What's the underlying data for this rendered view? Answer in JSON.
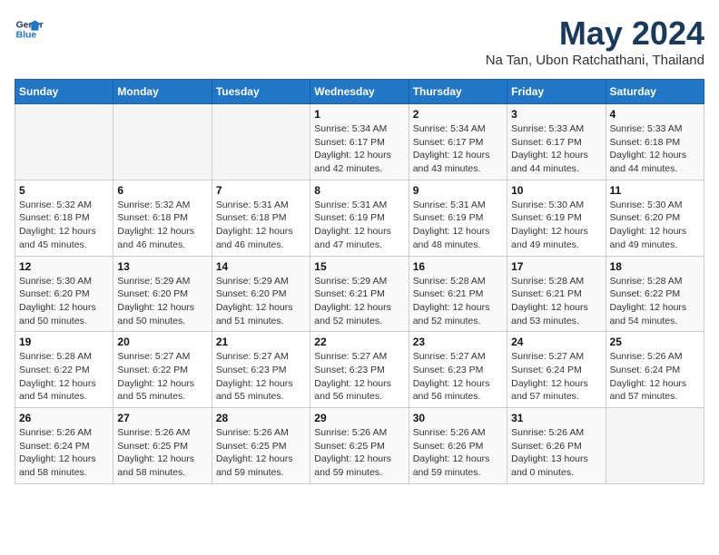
{
  "logo": {
    "line1": "General",
    "line2": "Blue"
  },
  "title": "May 2024",
  "subtitle": "Na Tan, Ubon Ratchathani, Thailand",
  "days_of_week": [
    "Sunday",
    "Monday",
    "Tuesday",
    "Wednesday",
    "Thursday",
    "Friday",
    "Saturday"
  ],
  "weeks": [
    [
      {
        "day": "",
        "info": ""
      },
      {
        "day": "",
        "info": ""
      },
      {
        "day": "",
        "info": ""
      },
      {
        "day": "1",
        "info": "Sunrise: 5:34 AM\nSunset: 6:17 PM\nDaylight: 12 hours\nand 42 minutes."
      },
      {
        "day": "2",
        "info": "Sunrise: 5:34 AM\nSunset: 6:17 PM\nDaylight: 12 hours\nand 43 minutes."
      },
      {
        "day": "3",
        "info": "Sunrise: 5:33 AM\nSunset: 6:17 PM\nDaylight: 12 hours\nand 44 minutes."
      },
      {
        "day": "4",
        "info": "Sunrise: 5:33 AM\nSunset: 6:18 PM\nDaylight: 12 hours\nand 44 minutes."
      }
    ],
    [
      {
        "day": "5",
        "info": "Sunrise: 5:32 AM\nSunset: 6:18 PM\nDaylight: 12 hours\nand 45 minutes."
      },
      {
        "day": "6",
        "info": "Sunrise: 5:32 AM\nSunset: 6:18 PM\nDaylight: 12 hours\nand 46 minutes."
      },
      {
        "day": "7",
        "info": "Sunrise: 5:31 AM\nSunset: 6:18 PM\nDaylight: 12 hours\nand 46 minutes."
      },
      {
        "day": "8",
        "info": "Sunrise: 5:31 AM\nSunset: 6:19 PM\nDaylight: 12 hours\nand 47 minutes."
      },
      {
        "day": "9",
        "info": "Sunrise: 5:31 AM\nSunset: 6:19 PM\nDaylight: 12 hours\nand 48 minutes."
      },
      {
        "day": "10",
        "info": "Sunrise: 5:30 AM\nSunset: 6:19 PM\nDaylight: 12 hours\nand 49 minutes."
      },
      {
        "day": "11",
        "info": "Sunrise: 5:30 AM\nSunset: 6:20 PM\nDaylight: 12 hours\nand 49 minutes."
      }
    ],
    [
      {
        "day": "12",
        "info": "Sunrise: 5:30 AM\nSunset: 6:20 PM\nDaylight: 12 hours\nand 50 minutes."
      },
      {
        "day": "13",
        "info": "Sunrise: 5:29 AM\nSunset: 6:20 PM\nDaylight: 12 hours\nand 50 minutes."
      },
      {
        "day": "14",
        "info": "Sunrise: 5:29 AM\nSunset: 6:20 PM\nDaylight: 12 hours\nand 51 minutes."
      },
      {
        "day": "15",
        "info": "Sunrise: 5:29 AM\nSunset: 6:21 PM\nDaylight: 12 hours\nand 52 minutes."
      },
      {
        "day": "16",
        "info": "Sunrise: 5:28 AM\nSunset: 6:21 PM\nDaylight: 12 hours\nand 52 minutes."
      },
      {
        "day": "17",
        "info": "Sunrise: 5:28 AM\nSunset: 6:21 PM\nDaylight: 12 hours\nand 53 minutes."
      },
      {
        "day": "18",
        "info": "Sunrise: 5:28 AM\nSunset: 6:22 PM\nDaylight: 12 hours\nand 54 minutes."
      }
    ],
    [
      {
        "day": "19",
        "info": "Sunrise: 5:28 AM\nSunset: 6:22 PM\nDaylight: 12 hours\nand 54 minutes."
      },
      {
        "day": "20",
        "info": "Sunrise: 5:27 AM\nSunset: 6:22 PM\nDaylight: 12 hours\nand 55 minutes."
      },
      {
        "day": "21",
        "info": "Sunrise: 5:27 AM\nSunset: 6:23 PM\nDaylight: 12 hours\nand 55 minutes."
      },
      {
        "day": "22",
        "info": "Sunrise: 5:27 AM\nSunset: 6:23 PM\nDaylight: 12 hours\nand 56 minutes."
      },
      {
        "day": "23",
        "info": "Sunrise: 5:27 AM\nSunset: 6:23 PM\nDaylight: 12 hours\nand 56 minutes."
      },
      {
        "day": "24",
        "info": "Sunrise: 5:27 AM\nSunset: 6:24 PM\nDaylight: 12 hours\nand 57 minutes."
      },
      {
        "day": "25",
        "info": "Sunrise: 5:26 AM\nSunset: 6:24 PM\nDaylight: 12 hours\nand 57 minutes."
      }
    ],
    [
      {
        "day": "26",
        "info": "Sunrise: 5:26 AM\nSunset: 6:24 PM\nDaylight: 12 hours\nand 58 minutes."
      },
      {
        "day": "27",
        "info": "Sunrise: 5:26 AM\nSunset: 6:25 PM\nDaylight: 12 hours\nand 58 minutes."
      },
      {
        "day": "28",
        "info": "Sunrise: 5:26 AM\nSunset: 6:25 PM\nDaylight: 12 hours\nand 59 minutes."
      },
      {
        "day": "29",
        "info": "Sunrise: 5:26 AM\nSunset: 6:25 PM\nDaylight: 12 hours\nand 59 minutes."
      },
      {
        "day": "30",
        "info": "Sunrise: 5:26 AM\nSunset: 6:26 PM\nDaylight: 12 hours\nand 59 minutes."
      },
      {
        "day": "31",
        "info": "Sunrise: 5:26 AM\nSunset: 6:26 PM\nDaylight: 13 hours\nand 0 minutes."
      },
      {
        "day": "",
        "info": ""
      }
    ]
  ]
}
